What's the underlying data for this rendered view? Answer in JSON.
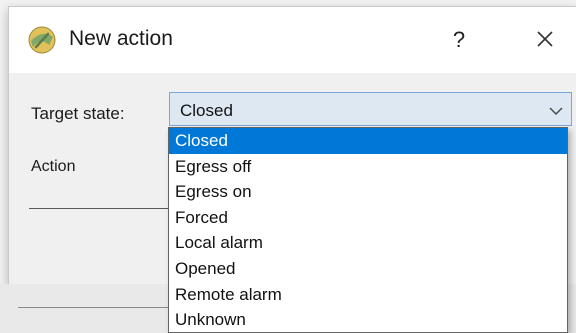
{
  "dialog": {
    "title": "New action",
    "help_label": "?",
    "icons": {
      "app": "app-icon",
      "close": "close-icon",
      "dropdown": "chevron-down-icon"
    },
    "target_state": {
      "label": "Target state:",
      "selected_value": "Closed",
      "options": [
        "Closed",
        "Egress off",
        "Egress on",
        "Forced",
        "Local alarm",
        "Opened",
        "Remote alarm",
        "Unknown"
      ]
    },
    "action_label": "Action"
  },
  "colors": {
    "selection": "#0078d7",
    "select_border": "#7aa7d8",
    "select_fill": "#dde8f3"
  }
}
